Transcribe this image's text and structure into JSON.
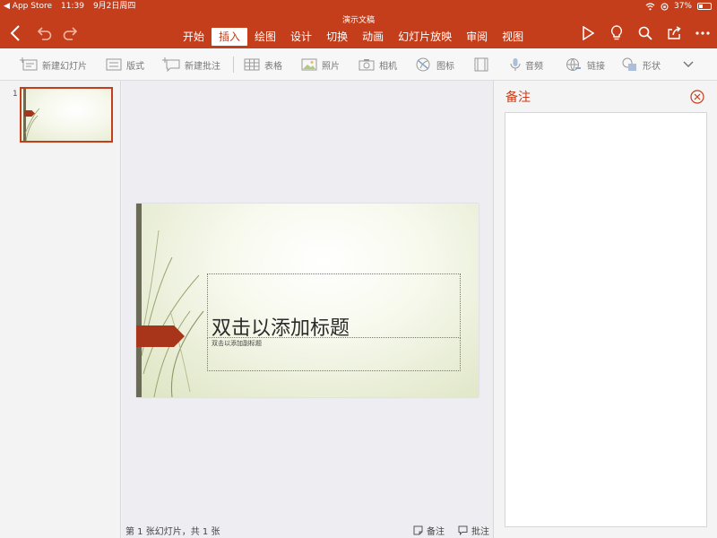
{
  "status": {
    "back_app": "◀ App Store",
    "time": "11:39",
    "date": "9月2日周四",
    "battery": "37%",
    "battery_level": 0.37
  },
  "document": {
    "title": "演示文稿"
  },
  "ribbon": {
    "tabs": [
      {
        "label": "开始"
      },
      {
        "label": "插入",
        "active": true
      },
      {
        "label": "绘图"
      },
      {
        "label": "设计"
      },
      {
        "label": "切换"
      },
      {
        "label": "动画"
      },
      {
        "label": "幻灯片放映"
      },
      {
        "label": "审阅"
      },
      {
        "label": "视图"
      }
    ]
  },
  "toolbar": {
    "new_slide": "新建幻灯片",
    "layout": "版式",
    "new_comment": "新建批注",
    "table": "表格",
    "pictures": "照片",
    "camera": "相机",
    "icons": "图标",
    "audio": "音频",
    "link": "链接",
    "shapes": "形状"
  },
  "thumbnails": {
    "items": [
      {
        "number": "1"
      }
    ]
  },
  "slide": {
    "title_placeholder": "双击以添加标题",
    "subtitle_placeholder": "双击以添加副标题"
  },
  "footer": {
    "slide_info": "第 1 张幻灯片，共 1 张",
    "notes_label": "备注",
    "comments_label": "批注"
  },
  "notes_pane": {
    "title": "备注"
  },
  "colors": {
    "accent": "#c43e1c"
  }
}
